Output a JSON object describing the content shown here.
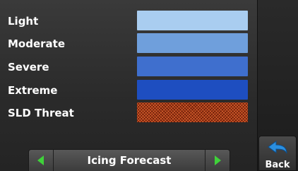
{
  "legend": {
    "rows": [
      {
        "label": "Light",
        "color": "#a9cdf0"
      },
      {
        "label": "Moderate",
        "color": "#6f9fdc"
      },
      {
        "label": "Severe",
        "color": "#3f6fce"
      },
      {
        "label": "Extreme",
        "color": "#1e4ec0"
      },
      {
        "label": "SLD Threat",
        "color": "#6e1e08",
        "pattern": "crosshatch"
      }
    ]
  },
  "nav": {
    "title": "Icing Forecast",
    "prev_icon": "left-arrow-icon",
    "next_icon": "right-arrow-icon",
    "arrow_color": "#3fd23a"
  },
  "back_button": {
    "label": "Back",
    "icon": "back-arrow-icon",
    "icon_color": "#2a8fe0"
  }
}
